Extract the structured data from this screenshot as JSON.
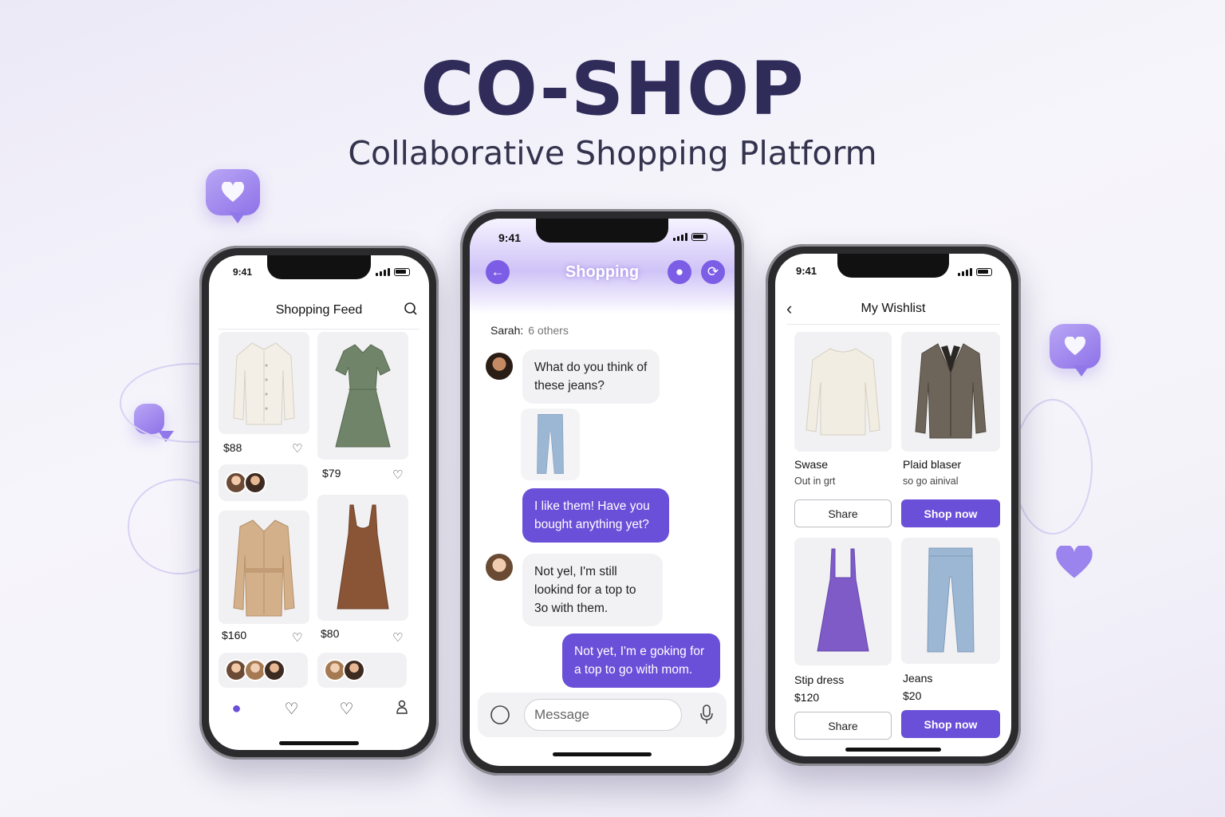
{
  "hero": {
    "title": "CO-SHOP",
    "subtitle": "Collaborative Shopping Platform"
  },
  "colors": {
    "accent": "#6a4fd8",
    "title": "#2f2c5a",
    "bubble": "#9b84ee"
  },
  "status": {
    "time": "9:41"
  },
  "feed": {
    "title": "Shopping Feed",
    "items": [
      {
        "image": "blouse",
        "price": "$88"
      },
      {
        "image": "green-dress",
        "price": "$79"
      },
      {
        "image": "trench-coat",
        "price": "$160"
      },
      {
        "image": "brown-dress",
        "price": "$80"
      }
    ],
    "nav": [
      "home-icon",
      "heart-icon",
      "heart-icon",
      "profile-icon"
    ]
  },
  "chat": {
    "title": "Shopping",
    "participants": {
      "name": "Sarah:",
      "others": "6 others"
    },
    "messages": [
      {
        "from": "in",
        "text": "What do you think of these jeans?"
      },
      {
        "from": "out",
        "text": "I like them! Have you bought anything yet?"
      },
      {
        "from": "in",
        "text": "Not yel, I'm still lookind for a top to 3o with them."
      },
      {
        "from": "out",
        "text": "Not yet, I'm e goking for a top to go with mom."
      }
    ],
    "composer": {
      "placeholder": "Message"
    }
  },
  "wishlist": {
    "title": "My Wishlist",
    "items": [
      {
        "image": "sweater",
        "name": "Swase",
        "sub": "Out in grt"
      },
      {
        "image": "plaid-blazer",
        "name": "Plaid blaser",
        "sub": "so go ainival"
      },
      {
        "image": "purple-slip-dress",
        "name": "Stip dress",
        "sub": "$120"
      },
      {
        "image": "jeans",
        "name": "Jeans",
        "sub": "$20"
      }
    ],
    "share_label": "Share",
    "shop_label": "Shop now"
  }
}
